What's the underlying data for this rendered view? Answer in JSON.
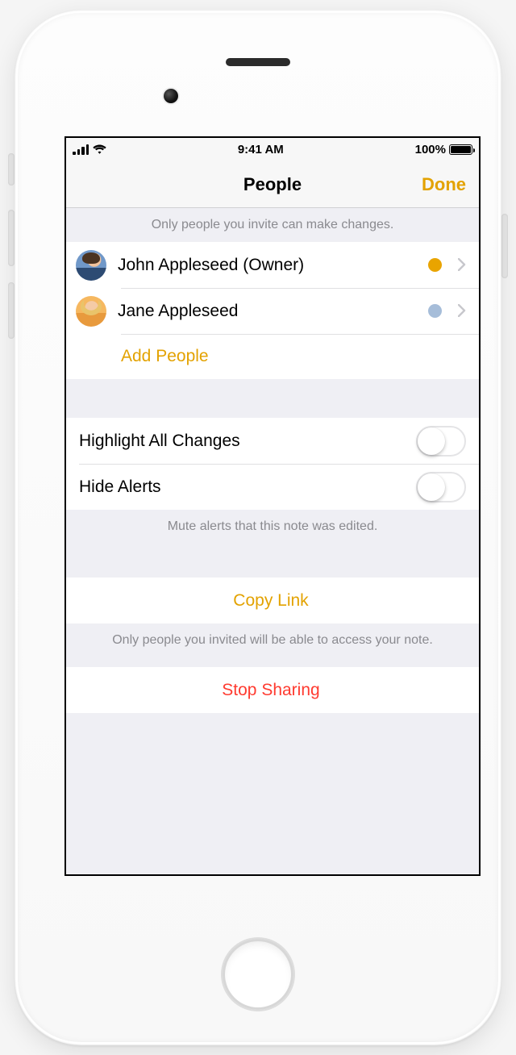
{
  "status": {
    "time": "9:41 AM",
    "battery_pct": "100%"
  },
  "nav": {
    "title": "People",
    "done": "Done"
  },
  "people_section": {
    "header": "Only people you invite can make changes.",
    "owner_name": "John Appleseed (Owner)",
    "invitee_name": "Jane Appleseed",
    "add_label": "Add People",
    "dot_colors": {
      "owner": "#e9a400",
      "invitee": "#a6bdd9"
    }
  },
  "toggles": {
    "highlight_label": "Highlight All Changes",
    "hide_alerts_label": "Hide Alerts",
    "footer": "Mute alerts that this note was edited."
  },
  "copy_link": {
    "label": "Copy Link",
    "footer": "Only people you invited will be able to access your note."
  },
  "stop_sharing": {
    "label": "Stop Sharing"
  }
}
